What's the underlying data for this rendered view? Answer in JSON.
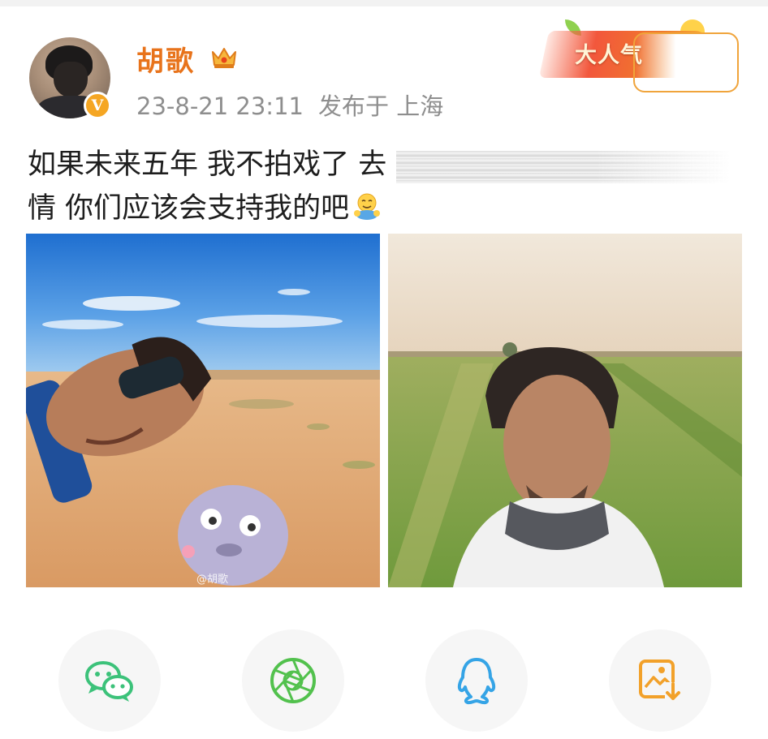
{
  "post": {
    "author": {
      "name": "胡歌",
      "verified_badge": "V",
      "crown_icon": "crown-icon"
    },
    "timestamp": "23-8-21 23:11",
    "location": "发布于 上海",
    "tag_label": "大人气",
    "text_line_1": "如果未来五年 我不拍戏了 去",
    "text_line_2": "情 你们应该会支持我的吧",
    "inline_emoji": "hug-emoji",
    "images": [
      {
        "subject": "desert-selfie",
        "watermark": "@胡歌"
      },
      {
        "subject": "field-selfie"
      }
    ]
  },
  "share": {
    "buttons": [
      {
        "icon": "wechat-icon",
        "color": "#3cc27a"
      },
      {
        "icon": "moments-icon",
        "color": "#52c14d"
      },
      {
        "icon": "qq-icon",
        "color": "#35a4e6"
      },
      {
        "icon": "save-image-icon",
        "color": "#f2a12a"
      }
    ]
  },
  "colors": {
    "username": "#e8731b",
    "meta": "#8e8e8e",
    "badge": "#f5a623",
    "share_bg": "#f6f6f6"
  }
}
